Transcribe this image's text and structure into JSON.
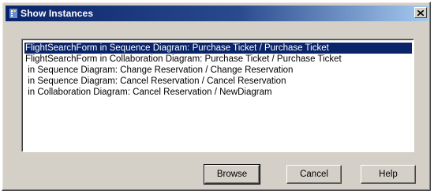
{
  "window": {
    "title": "Show Instances",
    "icon": "app-icon",
    "close_icon": "close-icon"
  },
  "instances": [
    "FlightSearchForm in Sequence Diagram: Purchase Ticket / Purchase Ticket",
    "FlightSearchForm in Collaboration Diagram: Purchase Ticket / Purchase Ticket",
    " in Sequence Diagram: Change Reservation / Change Reservation",
    " in Sequence Diagram: Cancel Reservation / Cancel Reservation",
    " in Collaboration Diagram: Cancel Reservation / NewDiagram"
  ],
  "selected_index": 0,
  "buttons": {
    "browse": "Browse",
    "cancel": "Cancel",
    "help": "Help"
  },
  "colors": {
    "selection": "#0a246a",
    "titlebar_start": "#0a246a",
    "titlebar_end": "#a6caf0",
    "face": "#d4d0c8"
  }
}
